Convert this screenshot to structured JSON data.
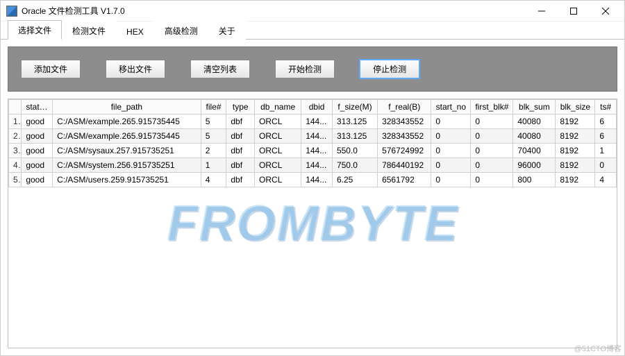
{
  "window": {
    "title": "Oracle 文件检测工具  V1.7.0"
  },
  "tabs": [
    {
      "label": "选择文件",
      "active": true
    },
    {
      "label": "检测文件",
      "active": false
    },
    {
      "label": "HEX",
      "active": false
    },
    {
      "label": "高级检测",
      "active": false
    },
    {
      "label": "关于",
      "active": false
    }
  ],
  "toolbar": {
    "add": "添加文件",
    "remove": "移出文件",
    "clear": "清空列表",
    "start": "开始检测",
    "stop": "停止检测"
  },
  "table": {
    "headers": [
      "status",
      "file_path",
      "file#",
      "type",
      "db_name",
      "dbid",
      "f_size(M)",
      "f_real(B)",
      "start_no",
      "first_blk#",
      "blk_sum",
      "blk_size",
      "ts#"
    ],
    "rows": [
      {
        "n": "1",
        "status": "good",
        "file_path": "C:/ASM/example.265.915735445",
        "file_no": "5",
        "type": "dbf",
        "db_name": "ORCL",
        "dbid": "144...",
        "f_size": "313.125",
        "f_real": "328343552",
        "start_no": "0",
        "first_blk": "0",
        "blk_sum": "40080",
        "blk_size": "8192",
        "ts_no": "6"
      },
      {
        "n": "2",
        "status": "good",
        "file_path": "C:/ASM/example.265.915735445",
        "file_no": "5",
        "type": "dbf",
        "db_name": "ORCL",
        "dbid": "144...",
        "f_size": "313.125",
        "f_real": "328343552",
        "start_no": "0",
        "first_blk": "0",
        "blk_sum": "40080",
        "blk_size": "8192",
        "ts_no": "6"
      },
      {
        "n": "3",
        "status": "good",
        "file_path": "C:/ASM/sysaux.257.915735251",
        "file_no": "2",
        "type": "dbf",
        "db_name": "ORCL",
        "dbid": "144...",
        "f_size": "550.0",
        "f_real": "576724992",
        "start_no": "0",
        "first_blk": "0",
        "blk_sum": "70400",
        "blk_size": "8192",
        "ts_no": "1"
      },
      {
        "n": "4",
        "status": "good",
        "file_path": "C:/ASM/system.256.915735251",
        "file_no": "1",
        "type": "dbf",
        "db_name": "ORCL",
        "dbid": "144...",
        "f_size": "750.0",
        "f_real": "786440192",
        "start_no": "0",
        "first_blk": "0",
        "blk_sum": "96000",
        "blk_size": "8192",
        "ts_no": "0"
      },
      {
        "n": "5",
        "status": "good",
        "file_path": "C:/ASM/users.259.915735251",
        "file_no": "4",
        "type": "dbf",
        "db_name": "ORCL",
        "dbid": "144...",
        "f_size": "6.25",
        "f_real": "6561792",
        "start_no": "0",
        "first_blk": "0",
        "blk_sum": "800",
        "blk_size": "8192",
        "ts_no": "4"
      }
    ]
  },
  "watermark": "FROMBYTE",
  "footer": "@51CTO博客"
}
